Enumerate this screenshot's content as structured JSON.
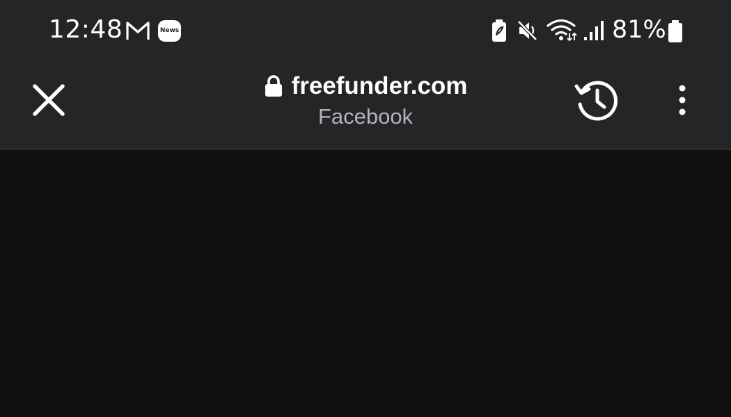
{
  "status_bar": {
    "time": "12:48",
    "notification_icons": [
      "gmail-icon",
      "news-icon"
    ],
    "news_badge_text": "News",
    "system_icons": [
      "battery-saver-icon",
      "mute-icon",
      "wifi-icon",
      "signal-icon",
      "battery-icon"
    ],
    "battery_percent": "81%"
  },
  "toolbar": {
    "url": "freefunder.com",
    "subtitle": "Facebook",
    "secure": true,
    "close_icon": "close-icon",
    "history_icon": "history-icon",
    "menu_icon": "more-vert-icon"
  },
  "colors": {
    "bar_background": "#242526",
    "page_background": "#101010",
    "text_primary": "#ffffff",
    "text_secondary": "#b0b3b8"
  }
}
